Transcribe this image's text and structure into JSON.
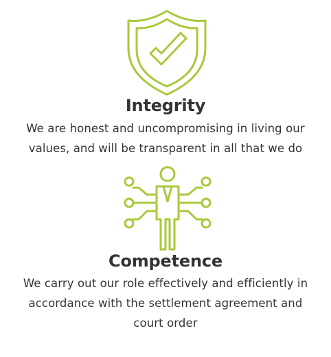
{
  "accent_color": "#a8c93a",
  "values": [
    {
      "icon": "shield-check-icon",
      "title": "Integrity",
      "description_lines": [
        "We are honest and uncompromising in living our",
        "values, and will be transparent in all that we do"
      ]
    },
    {
      "icon": "person-network-icon",
      "title": "Competence",
      "description_lines": [
        "We carry out our role effectively and efficiently in",
        "accordance with the settlement agreement and",
        "court order"
      ]
    }
  ]
}
